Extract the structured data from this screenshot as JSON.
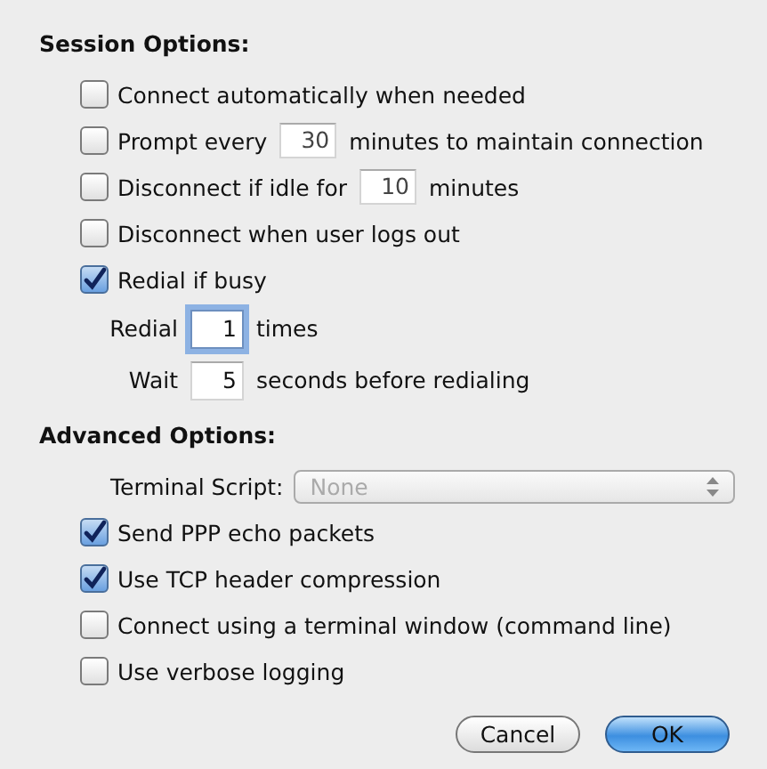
{
  "session_options": {
    "title": "Session Options:",
    "items": [
      {
        "kind": "check",
        "checked": false,
        "label": "Connect automatically when needed"
      },
      {
        "kind": "check_field",
        "checked": false,
        "before": "Prompt every",
        "value": "30",
        "after": "minutes to maintain connection"
      },
      {
        "kind": "check_field",
        "checked": false,
        "before": "Disconnect if idle for",
        "value": "10",
        "after": "minutes"
      },
      {
        "kind": "check",
        "checked": false,
        "label": "Disconnect when user logs out"
      },
      {
        "kind": "check",
        "checked": true,
        "label": "Redial if busy"
      },
      {
        "kind": "field",
        "before": "Redial",
        "value": "1",
        "after": "times",
        "focused": true
      },
      {
        "kind": "field",
        "before": "Wait",
        "value": "5",
        "after": "seconds before redialing",
        "focused": false
      }
    ]
  },
  "advanced_options": {
    "title": "Advanced Options:",
    "items": [
      {
        "kind": "popup",
        "label": "Terminal Script:",
        "value": "None",
        "disabled": true
      },
      {
        "kind": "check",
        "checked": true,
        "label": "Send PPP echo packets"
      },
      {
        "kind": "check",
        "checked": true,
        "label": "Use TCP header compression"
      },
      {
        "kind": "check",
        "checked": false,
        "label": "Connect using a terminal window (command line)"
      },
      {
        "kind": "check",
        "checked": false,
        "label": "Use verbose logging"
      }
    ]
  },
  "buttons": [
    {
      "label": "Cancel",
      "default": false
    },
    {
      "label": "OK",
      "default": true
    }
  ]
}
